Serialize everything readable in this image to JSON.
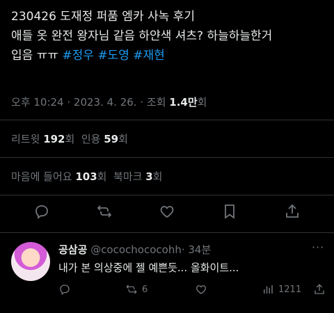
{
  "tweet": {
    "line1": "230426 도재정 퍼품 엠카 사녹 후기",
    "line2": "애들 옷 완전 왕자님 같음 하얀색 셔츠? 하늘하늘한거",
    "line3_text": "입음 ㅠㅠ ",
    "hashtags": [
      "#정우",
      "#도영",
      "#재현"
    ],
    "time": "오후 10:24",
    "date": "2023. 4. 26.",
    "views_label": "조회",
    "views_count": "1.4만",
    "views_suffix": "회"
  },
  "stats": {
    "retweets_label": "리트윗",
    "retweets_count": "192",
    "retweets_suffix": "회",
    "quotes_label": "인용",
    "quotes_count": "59",
    "quotes_suffix": "회",
    "likes_label": "마음에 들어요",
    "likes_count": "103",
    "likes_suffix": "회",
    "bookmarks_label": "북마크",
    "bookmarks_count": "3",
    "bookmarks_suffix": "회"
  },
  "actions": {
    "icons": [
      "reply-icon",
      "retweet-icon",
      "like-icon",
      "bookmark-icon",
      "share-icon"
    ]
  },
  "reply": {
    "name": "공삼공",
    "handle": "@cocochococohh",
    "time": "· 34분",
    "text": "내가 본 의상중에 젤 예쁜듯... 올화이트...",
    "retweets": "6",
    "views": "1211",
    "more": "···"
  },
  "colors": {
    "background": "#000000",
    "text": "#e7e9ea",
    "muted": "#71767b",
    "accent": "#1d9bf0",
    "divider": "#2f3336"
  }
}
